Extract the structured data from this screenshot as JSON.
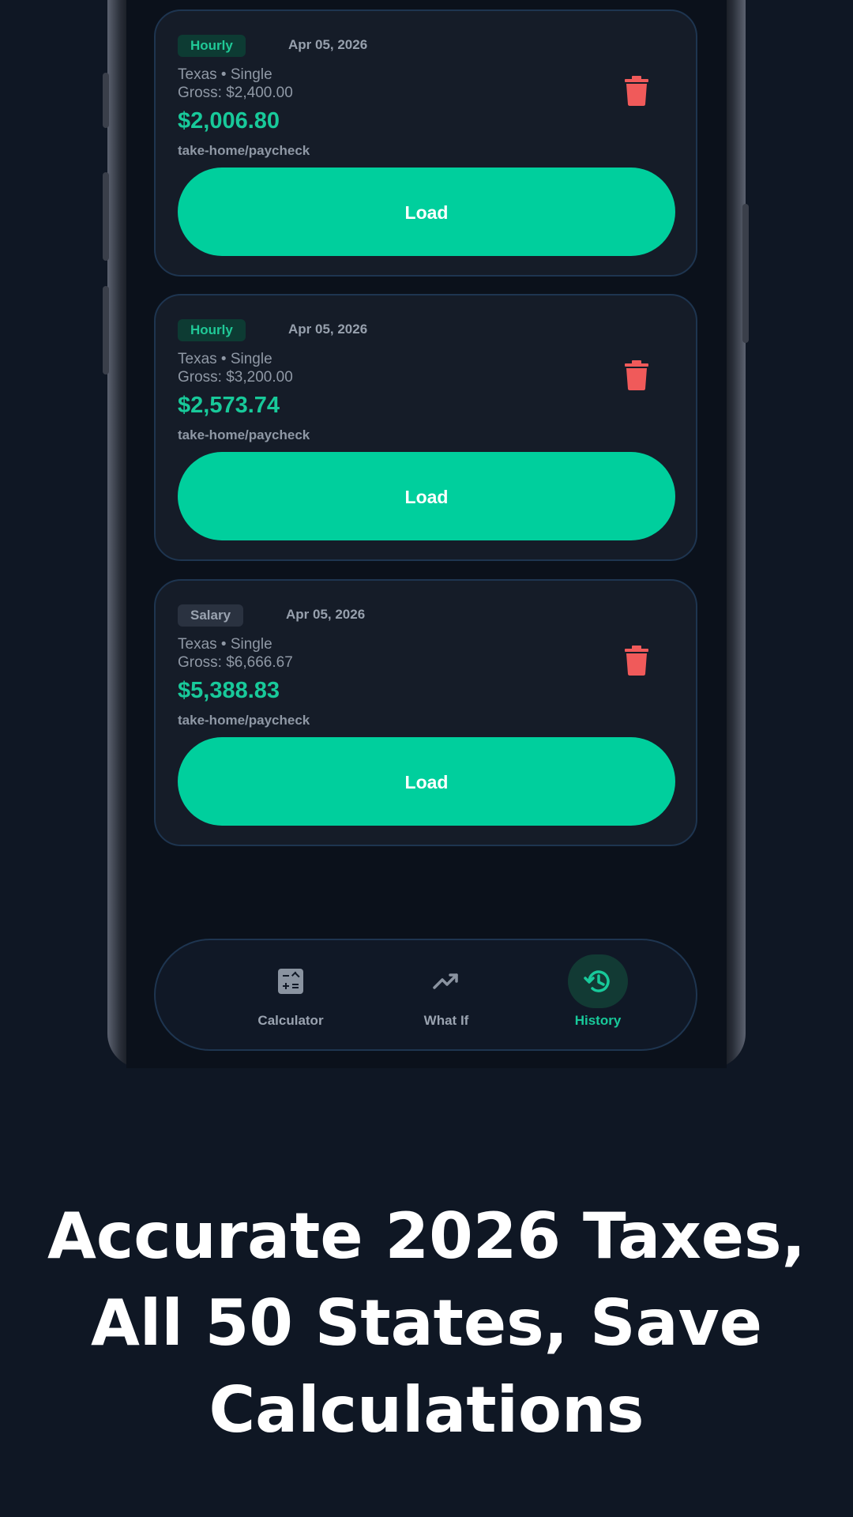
{
  "cards": [
    {
      "badge": "Hourly",
      "badge_type": "hourly",
      "date": "Apr 05, 2026",
      "location": "Texas • Single",
      "gross": "Gross: $2,400.00",
      "amount": "$2,006.80",
      "amount_sub": "take-home/paycheck",
      "load_label": "Load"
    },
    {
      "badge": "Hourly",
      "badge_type": "hourly",
      "date": "Apr 05, 2026",
      "location": "Texas • Single",
      "gross": "Gross: $3,200.00",
      "amount": "$2,573.74",
      "amount_sub": "take-home/paycheck",
      "load_label": "Load"
    },
    {
      "badge": "Salary",
      "badge_type": "salary",
      "date": "Apr 05, 2026",
      "location": "Texas • Single",
      "gross": "Gross: $6,666.67",
      "amount": "$5,388.83",
      "amount_sub": "take-home/paycheck",
      "load_label": "Load"
    }
  ],
  "nav": {
    "items": [
      {
        "label": "Calculator",
        "icon": "calculator-icon",
        "active": false
      },
      {
        "label": "What If",
        "icon": "trending-up-icon",
        "active": false
      },
      {
        "label": "History",
        "icon": "history-icon",
        "active": true
      }
    ]
  },
  "caption": {
    "line1": "Accurate 2026 Taxes,",
    "line2": "All 50 States, Save",
    "line3": "Calculations"
  },
  "colors": {
    "accent": "#00cf9d",
    "delete": "#f05a5a",
    "background": "#0f1724"
  }
}
